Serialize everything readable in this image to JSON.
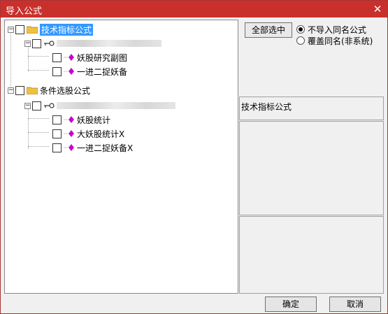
{
  "window": {
    "title": "导入公式",
    "close_glyph": "✕"
  },
  "tree": {
    "groups": [
      {
        "label": "技术指标公式",
        "expanded": true,
        "checked": false,
        "selected": true,
        "subgroup": {
          "label": "",
          "expanded": true,
          "items": [
            "妖股研究副图",
            "一进二捉妖备"
          ]
        }
      },
      {
        "label": "条件选股公式",
        "expanded": true,
        "checked": false,
        "selected": false,
        "subgroup": {
          "label": "",
          "expanded": true,
          "items": [
            "妖股统计",
            "大妖股统计X",
            "一进二捉妖备X"
          ]
        }
      }
    ],
    "expander_glyph": "−"
  },
  "options": {
    "select_all_label": "全部选中",
    "radio_no_import": "不导入同名公式",
    "radio_overwrite": "覆盖同名(非系统)",
    "selected_radio": "no_import"
  },
  "description": {
    "label": "技术指标公式"
  },
  "buttons": {
    "ok": "确定",
    "cancel": "取消"
  },
  "colors": {
    "titlebar": "#c9302c",
    "selection": "#3399ff",
    "formula_icon": "#cc00cc",
    "folder_icon": "#f0c040"
  }
}
